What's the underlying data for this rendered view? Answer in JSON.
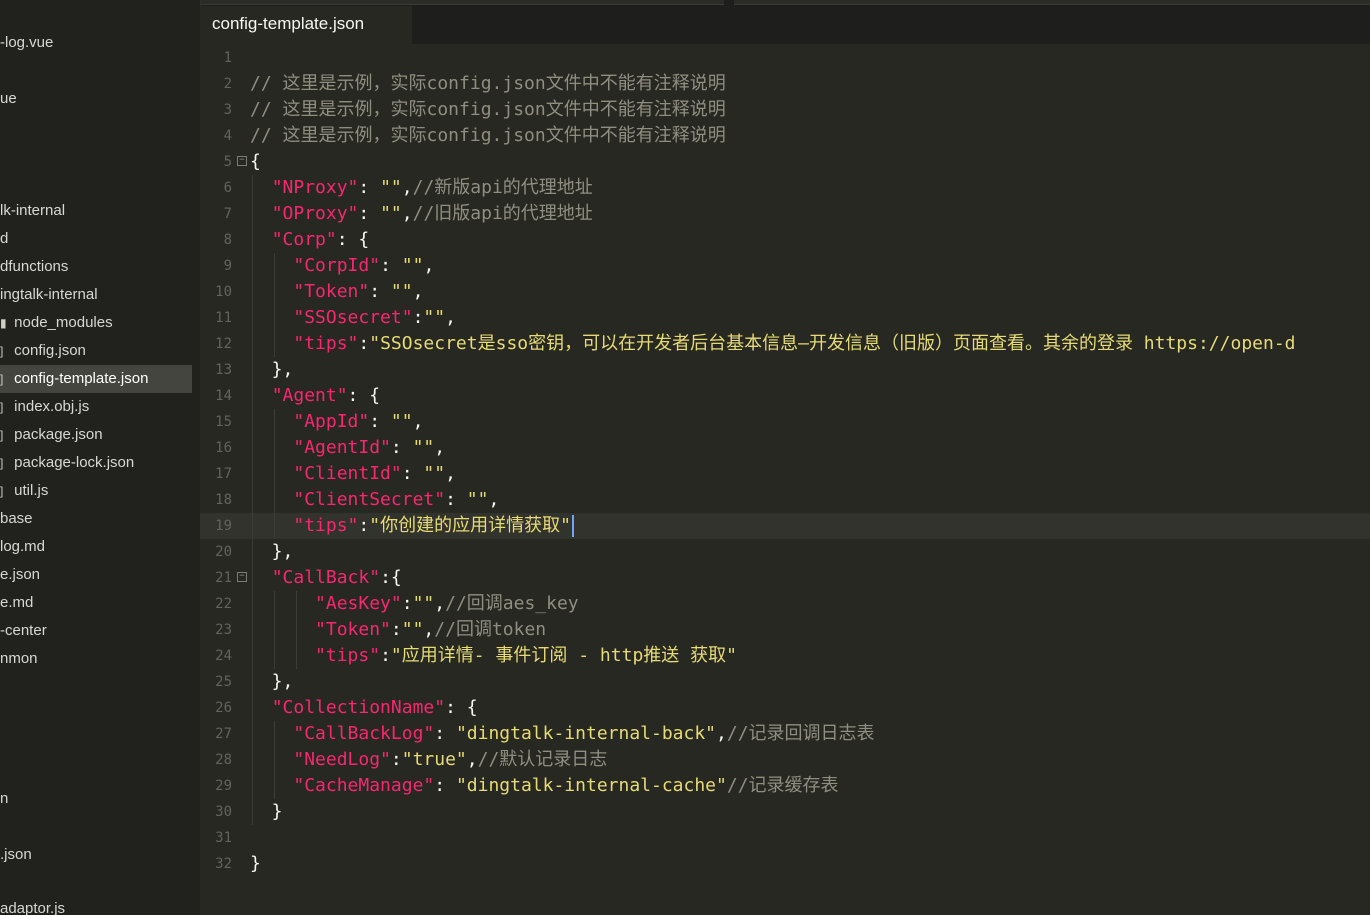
{
  "sidebar": {
    "items": [
      {
        "label": "-log.vue",
        "selected": false
      },
      {
        "label": "ue",
        "selected": false
      },
      {
        "label": "lk-internal",
        "selected": false
      },
      {
        "label": "d",
        "selected": false
      },
      {
        "label": "dfunctions",
        "selected": false
      },
      {
        "label": "ingtalk-internal",
        "selected": false
      },
      {
        "label": "node_modules",
        "selected": false
      },
      {
        "label": "config.json",
        "selected": false
      },
      {
        "label": "config-template.json",
        "selected": true
      },
      {
        "label": "index.obj.js",
        "selected": false
      },
      {
        "label": "package.json",
        "selected": false
      },
      {
        "label": "package-lock.json",
        "selected": false
      },
      {
        "label": "util.js",
        "selected": false
      },
      {
        "label": "base",
        "selected": false
      },
      {
        "label": "log.md",
        "selected": false
      },
      {
        "label": "e.json",
        "selected": false
      },
      {
        "label": "e.md",
        "selected": false
      },
      {
        "label": "-center",
        "selected": false
      },
      {
        "label": "nmon",
        "selected": false
      },
      {
        "label": "n",
        "selected": false
      },
      {
        "label": ".json",
        "selected": false
      },
      {
        "label": "adaptor.js",
        "selected": false
      }
    ]
  },
  "tab": {
    "title": "config-template.json"
  },
  "editor": {
    "current_line": 19,
    "lines": [
      {
        "n": "1",
        "tokens": []
      },
      {
        "n": "2",
        "tokens": [
          {
            "t": "// 这里是示例，实际config.json文件中不能有注释说明",
            "c": "c"
          }
        ]
      },
      {
        "n": "3",
        "tokens": [
          {
            "t": "// 这里是示例，实际config.json文件中不能有注释说明",
            "c": "c"
          }
        ]
      },
      {
        "n": "4",
        "tokens": [
          {
            "t": "// 这里是示例，实际config.json文件中不能有注释说明",
            "c": "c"
          }
        ]
      },
      {
        "n": "5",
        "fold": true,
        "tokens": [
          {
            "t": "{",
            "c": "p"
          }
        ]
      },
      {
        "n": "6",
        "tokens": [
          {
            "t": "  ",
            "c": "p"
          },
          {
            "t": "\"NProxy\"",
            "c": "k"
          },
          {
            "t": ": ",
            "c": "p"
          },
          {
            "t": "\"\"",
            "c": "s"
          },
          {
            "t": ",",
            "c": "p"
          },
          {
            "t": "//新版api的代理地址",
            "c": "c"
          }
        ]
      },
      {
        "n": "7",
        "tokens": [
          {
            "t": "  ",
            "c": "p"
          },
          {
            "t": "\"OProxy\"",
            "c": "k"
          },
          {
            "t": ": ",
            "c": "p"
          },
          {
            "t": "\"\"",
            "c": "s"
          },
          {
            "t": ",",
            "c": "p"
          },
          {
            "t": "//旧版api的代理地址",
            "c": "c"
          }
        ]
      },
      {
        "n": "8",
        "tokens": [
          {
            "t": "  ",
            "c": "p"
          },
          {
            "t": "\"Corp\"",
            "c": "k"
          },
          {
            "t": ": {",
            "c": "p"
          }
        ]
      },
      {
        "n": "9",
        "tokens": [
          {
            "t": "    ",
            "c": "p"
          },
          {
            "t": "\"CorpId\"",
            "c": "k"
          },
          {
            "t": ": ",
            "c": "p"
          },
          {
            "t": "\"\"",
            "c": "s"
          },
          {
            "t": ",",
            "c": "p"
          }
        ]
      },
      {
        "n": "10",
        "tokens": [
          {
            "t": "    ",
            "c": "p"
          },
          {
            "t": "\"Token\"",
            "c": "k"
          },
          {
            "t": ": ",
            "c": "p"
          },
          {
            "t": "\"\"",
            "c": "s"
          },
          {
            "t": ",",
            "c": "p"
          }
        ]
      },
      {
        "n": "11",
        "tokens": [
          {
            "t": "    ",
            "c": "p"
          },
          {
            "t": "\"SSOsecret\"",
            "c": "k"
          },
          {
            "t": ":",
            "c": "p"
          },
          {
            "t": "\"\"",
            "c": "s"
          },
          {
            "t": ",",
            "c": "p"
          }
        ]
      },
      {
        "n": "12",
        "tokens": [
          {
            "t": "    ",
            "c": "p"
          },
          {
            "t": "\"tips\"",
            "c": "k"
          },
          {
            "t": ":",
            "c": "p"
          },
          {
            "t": "\"SSOsecret是sso密钥，可以在开发者后台基本信息—开发信息（旧版）页面查看。其余的登录 https://open-d",
            "c": "s"
          }
        ]
      },
      {
        "n": "13",
        "tokens": [
          {
            "t": "  },",
            "c": "p"
          }
        ]
      },
      {
        "n": "14",
        "tokens": [
          {
            "t": "  ",
            "c": "p"
          },
          {
            "t": "\"Agent\"",
            "c": "k"
          },
          {
            "t": ": {",
            "c": "p"
          }
        ]
      },
      {
        "n": "15",
        "tokens": [
          {
            "t": "    ",
            "c": "p"
          },
          {
            "t": "\"AppId\"",
            "c": "k"
          },
          {
            "t": ": ",
            "c": "p"
          },
          {
            "t": "\"\"",
            "c": "s"
          },
          {
            "t": ",",
            "c": "p"
          }
        ]
      },
      {
        "n": "16",
        "tokens": [
          {
            "t": "    ",
            "c": "p"
          },
          {
            "t": "\"AgentId\"",
            "c": "k"
          },
          {
            "t": ": ",
            "c": "p"
          },
          {
            "t": "\"\"",
            "c": "s"
          },
          {
            "t": ",",
            "c": "p"
          }
        ]
      },
      {
        "n": "17",
        "tokens": [
          {
            "t": "    ",
            "c": "p"
          },
          {
            "t": "\"ClientId\"",
            "c": "k"
          },
          {
            "t": ": ",
            "c": "p"
          },
          {
            "t": "\"\"",
            "c": "s"
          },
          {
            "t": ",",
            "c": "p"
          }
        ]
      },
      {
        "n": "18",
        "tokens": [
          {
            "t": "    ",
            "c": "p"
          },
          {
            "t": "\"ClientSecret\"",
            "c": "k"
          },
          {
            "t": ": ",
            "c": "p"
          },
          {
            "t": "\"\"",
            "c": "s"
          },
          {
            "t": ",",
            "c": "p"
          }
        ]
      },
      {
        "n": "19",
        "tokens": [
          {
            "t": "    ",
            "c": "p"
          },
          {
            "t": "\"tips\"",
            "c": "k"
          },
          {
            "t": ":",
            "c": "p"
          },
          {
            "t": "\"你创建的应用详情获取\"",
            "c": "s"
          }
        ]
      },
      {
        "n": "20",
        "tokens": [
          {
            "t": "  },",
            "c": "p"
          }
        ]
      },
      {
        "n": "21",
        "fold": true,
        "tokens": [
          {
            "t": "  ",
            "c": "p"
          },
          {
            "t": "\"CallBack\"",
            "c": "k"
          },
          {
            "t": ":{",
            "c": "p"
          }
        ]
      },
      {
        "n": "22",
        "tokens": [
          {
            "t": "      ",
            "c": "p"
          },
          {
            "t": "\"AesKey\"",
            "c": "k"
          },
          {
            "t": ":",
            "c": "p"
          },
          {
            "t": "\"\"",
            "c": "s"
          },
          {
            "t": ",",
            "c": "p"
          },
          {
            "t": "//回调aes_key",
            "c": "c"
          }
        ]
      },
      {
        "n": "23",
        "tokens": [
          {
            "t": "      ",
            "c": "p"
          },
          {
            "t": "\"Token\"",
            "c": "k"
          },
          {
            "t": ":",
            "c": "p"
          },
          {
            "t": "\"\"",
            "c": "s"
          },
          {
            "t": ",",
            "c": "p"
          },
          {
            "t": "//回调token",
            "c": "c"
          }
        ]
      },
      {
        "n": "24",
        "tokens": [
          {
            "t": "      ",
            "c": "p"
          },
          {
            "t": "\"tips\"",
            "c": "k"
          },
          {
            "t": ":",
            "c": "p"
          },
          {
            "t": "\"应用详情- 事件订阅 - http推送 获取\"",
            "c": "s"
          }
        ]
      },
      {
        "n": "25",
        "tokens": [
          {
            "t": "  },",
            "c": "p"
          }
        ]
      },
      {
        "n": "26",
        "tokens": [
          {
            "t": "  ",
            "c": "p"
          },
          {
            "t": "\"CollectionName\"",
            "c": "k"
          },
          {
            "t": ": {",
            "c": "p"
          }
        ]
      },
      {
        "n": "27",
        "tokens": [
          {
            "t": "    ",
            "c": "p"
          },
          {
            "t": "\"CallBackLog\"",
            "c": "k"
          },
          {
            "t": ": ",
            "c": "p"
          },
          {
            "t": "\"dingtalk-internal-back\"",
            "c": "s"
          },
          {
            "t": ",",
            "c": "p"
          },
          {
            "t": "//记录回调日志表",
            "c": "c"
          }
        ]
      },
      {
        "n": "28",
        "tokens": [
          {
            "t": "    ",
            "c": "p"
          },
          {
            "t": "\"NeedLog\"",
            "c": "k"
          },
          {
            "t": ":",
            "c": "p"
          },
          {
            "t": "\"true\"",
            "c": "s"
          },
          {
            "t": ",",
            "c": "p"
          },
          {
            "t": "//默认记录日志",
            "c": "c"
          }
        ]
      },
      {
        "n": "29",
        "tokens": [
          {
            "t": "    ",
            "c": "p"
          },
          {
            "t": "\"CacheManage\"",
            "c": "k"
          },
          {
            "t": ": ",
            "c": "p"
          },
          {
            "t": "\"dingtalk-internal-cache\"",
            "c": "s"
          },
          {
            "t": "//记录缓存表",
            "c": "c"
          }
        ]
      },
      {
        "n": "30",
        "tokens": [
          {
            "t": "  }",
            "c": "p"
          }
        ]
      },
      {
        "n": "31",
        "tokens": []
      },
      {
        "n": "32",
        "tokens": [
          {
            "t": "}",
            "c": "p"
          }
        ]
      }
    ]
  }
}
